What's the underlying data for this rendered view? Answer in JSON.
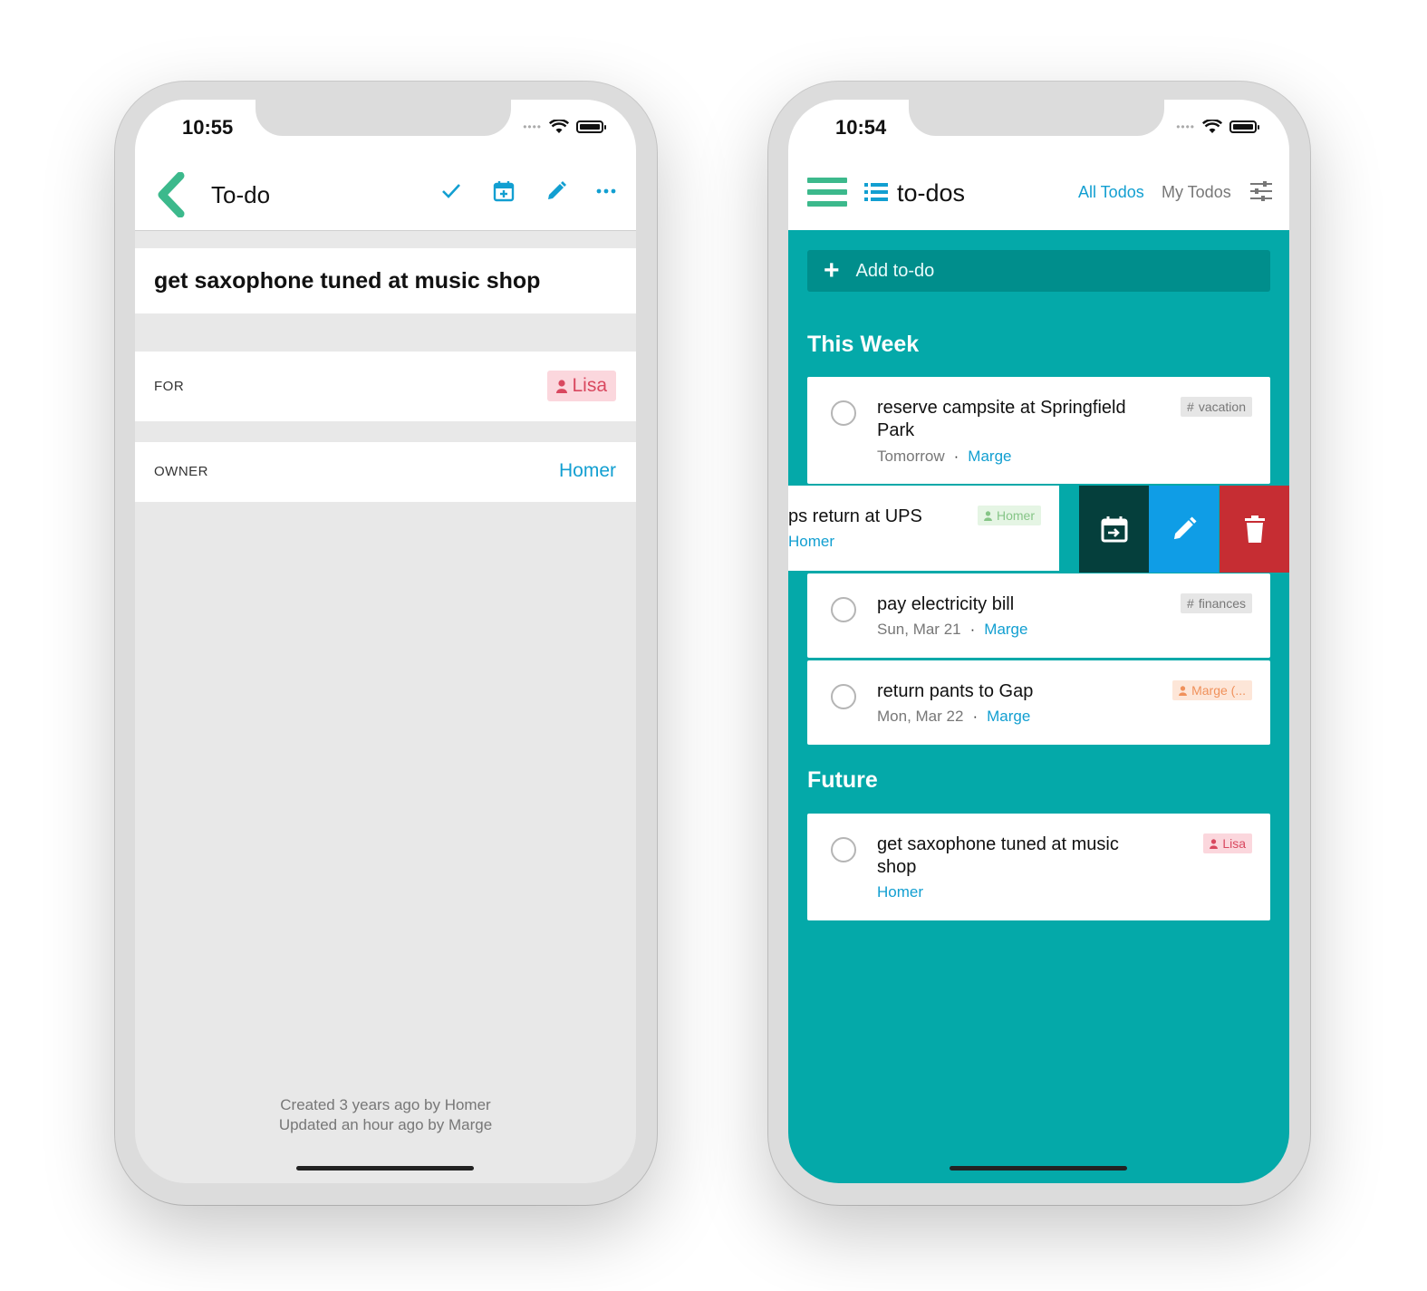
{
  "left_phone": {
    "status": {
      "time": "10:55"
    },
    "nav": {
      "title": "To-do",
      "icons": [
        "chevron-left-icon",
        "check-icon",
        "calendar-plus-icon",
        "pencil-icon",
        "more-icon"
      ]
    },
    "todo_title": "get saxophone tuned at music shop",
    "fields": {
      "for_label": "FOR",
      "for_value": "Lisa",
      "owner_label": "OWNER",
      "owner_value": "Homer"
    },
    "footer": {
      "created": "Created 3 years ago by Homer",
      "updated": "Updated an hour ago by Marge"
    }
  },
  "right_phone": {
    "status": {
      "time": "10:54"
    },
    "nav": {
      "title": "to-dos",
      "tab_all": "All Todos",
      "tab_my": "My Todos",
      "icons": [
        "hamburger-icon",
        "list-icon",
        "sliders-icon"
      ]
    },
    "add_label": "Add to-do",
    "sections": {
      "this_week": "This Week",
      "future": "Future"
    },
    "todos": [
      {
        "title_line1": "reserve campsite at Springfield",
        "title_line2": "Park",
        "date": "Tomorrow",
        "person": "Marge",
        "tag": "vacation",
        "tag_type": "hashtag"
      },
      {
        "title": "ps return at UPS",
        "person": "Homer",
        "tag": "Homer",
        "tag_type": "person",
        "swiped": true
      },
      {
        "title": "pay electricity bill",
        "date": "Sun, Mar 21",
        "person": "Marge",
        "tag": "finances",
        "tag_type": "hashtag"
      },
      {
        "title": "return pants to Gap",
        "date": "Mon, Mar 22",
        "person": "Marge",
        "tag": "Marge (...",
        "tag_type": "person"
      },
      {
        "title_line1": "get saxophone tuned at music",
        "title_line2": "shop",
        "person": "Homer",
        "tag": "Lisa",
        "tag_type": "person"
      }
    ],
    "swipe_actions": [
      "calendar-move-icon",
      "pencil-icon",
      "trash-icon"
    ],
    "colors": {
      "teal": "#04a9a9",
      "dark_teal": "#008e8c",
      "blue": "#129fd1",
      "red": "#c62d33",
      "green": "#3cb98c"
    }
  }
}
